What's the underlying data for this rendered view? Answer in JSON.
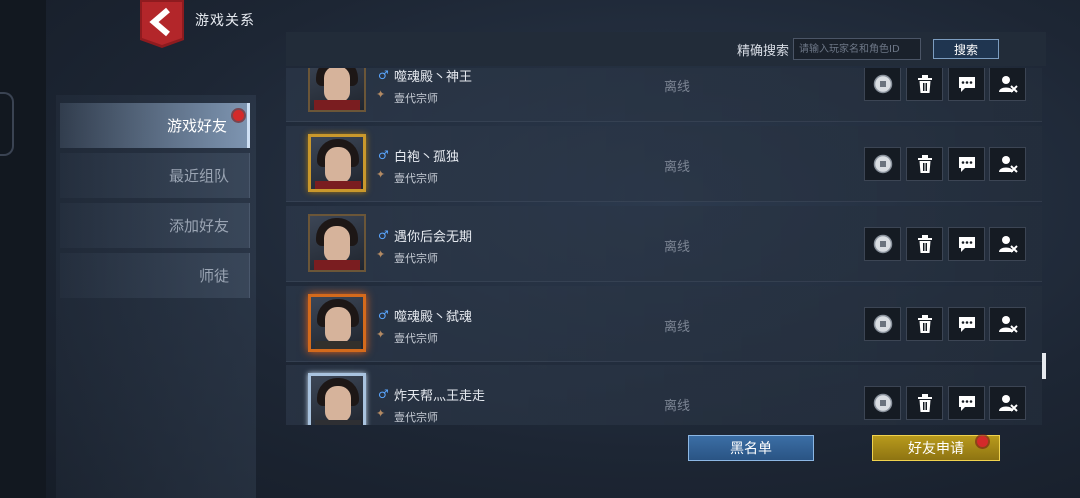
{
  "header": {
    "title": "游戏关系",
    "back_icon": "back-arrow-icon"
  },
  "sidebar": {
    "tabs": [
      {
        "label": "游戏好友",
        "active": true,
        "notification": true
      },
      {
        "label": "最近组队",
        "active": false
      },
      {
        "label": "添加好友",
        "active": false
      },
      {
        "label": "师徒",
        "active": false
      }
    ]
  },
  "search": {
    "label": "精确搜索",
    "placeholder": "请输入玩家名和角色ID",
    "value": "",
    "button_label": "搜索"
  },
  "friends": [
    {
      "name": "噬魂殿丶神王",
      "rank": "壹代宗师",
      "status": "离线",
      "frame": "plain",
      "gender": "male"
    },
    {
      "name": "白袍丶孤独",
      "rank": "壹代宗师",
      "status": "离线",
      "frame": "gold",
      "gender": "male"
    },
    {
      "name": "遇你后会无期",
      "rank": "壹代宗师",
      "status": "离线",
      "frame": "plain",
      "gender": "male"
    },
    {
      "name": "噬魂殿丶弑魂",
      "rank": "壹代宗师",
      "status": "离线",
      "frame": "fire",
      "gender": "male"
    },
    {
      "name": "炸天帮灬王走走",
      "rank": "壹代宗师",
      "status": "离线",
      "frame": "ice",
      "gender": "male"
    }
  ],
  "row_actions": [
    "coin-icon",
    "trash-icon",
    "chat-icon",
    "remove-friend-icon"
  ],
  "footer": {
    "blacklist_label": "黑名单",
    "friend_request_label": "好友申请",
    "friend_request_notification": true
  },
  "colors": {
    "accent_blue": "#3b6ea5",
    "accent_gold": "#b89a1c",
    "notification_red": "#d32a2a",
    "male_icon": "#5aa6ff"
  }
}
